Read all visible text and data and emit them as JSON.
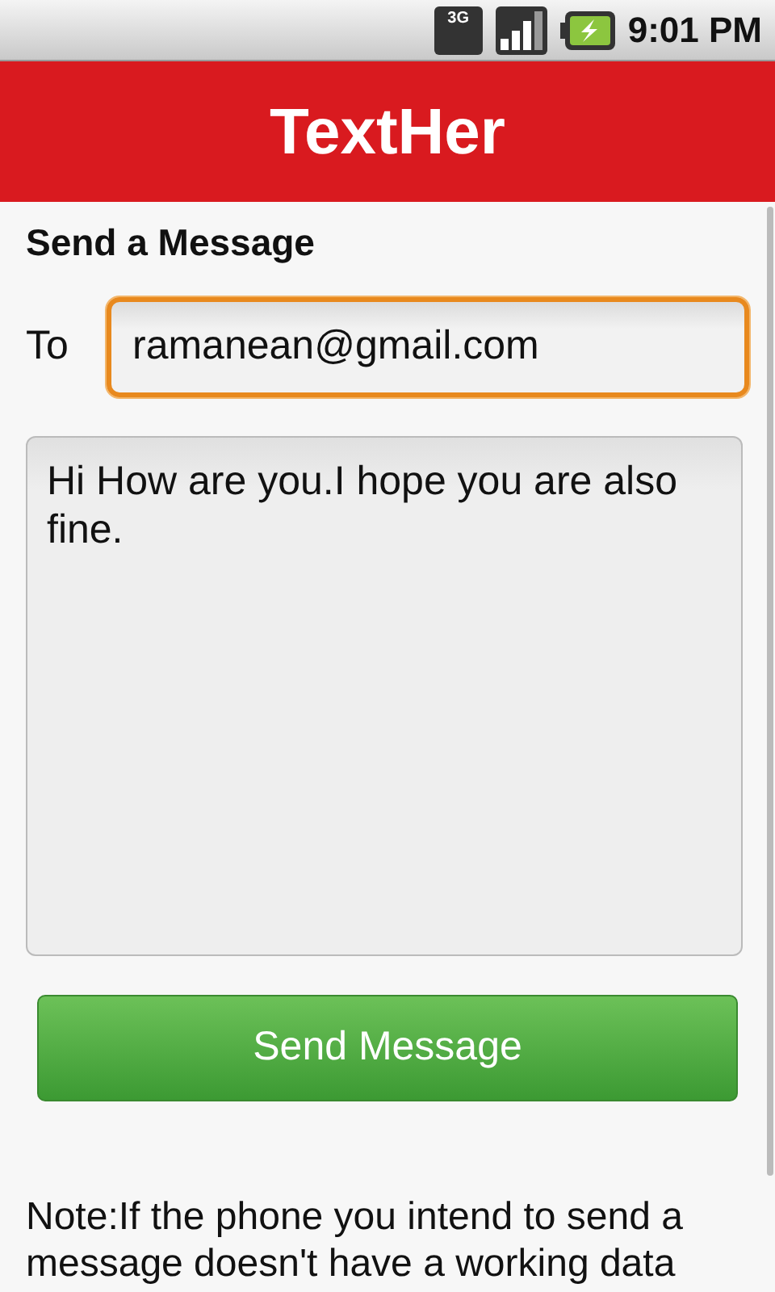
{
  "status_bar": {
    "network": "3G",
    "time": "9:01 PM"
  },
  "app_bar": {
    "title": "TextHer"
  },
  "form": {
    "heading": "Send a Message",
    "to_label": "To",
    "to_value": "ramanean@gmail.com",
    "to_focused": true,
    "message": "Hi How are you.I hope you are also fine.",
    "send_button": "Send Message"
  },
  "note": "Note:If the phone you intend to send a message doesn't have a working data"
}
